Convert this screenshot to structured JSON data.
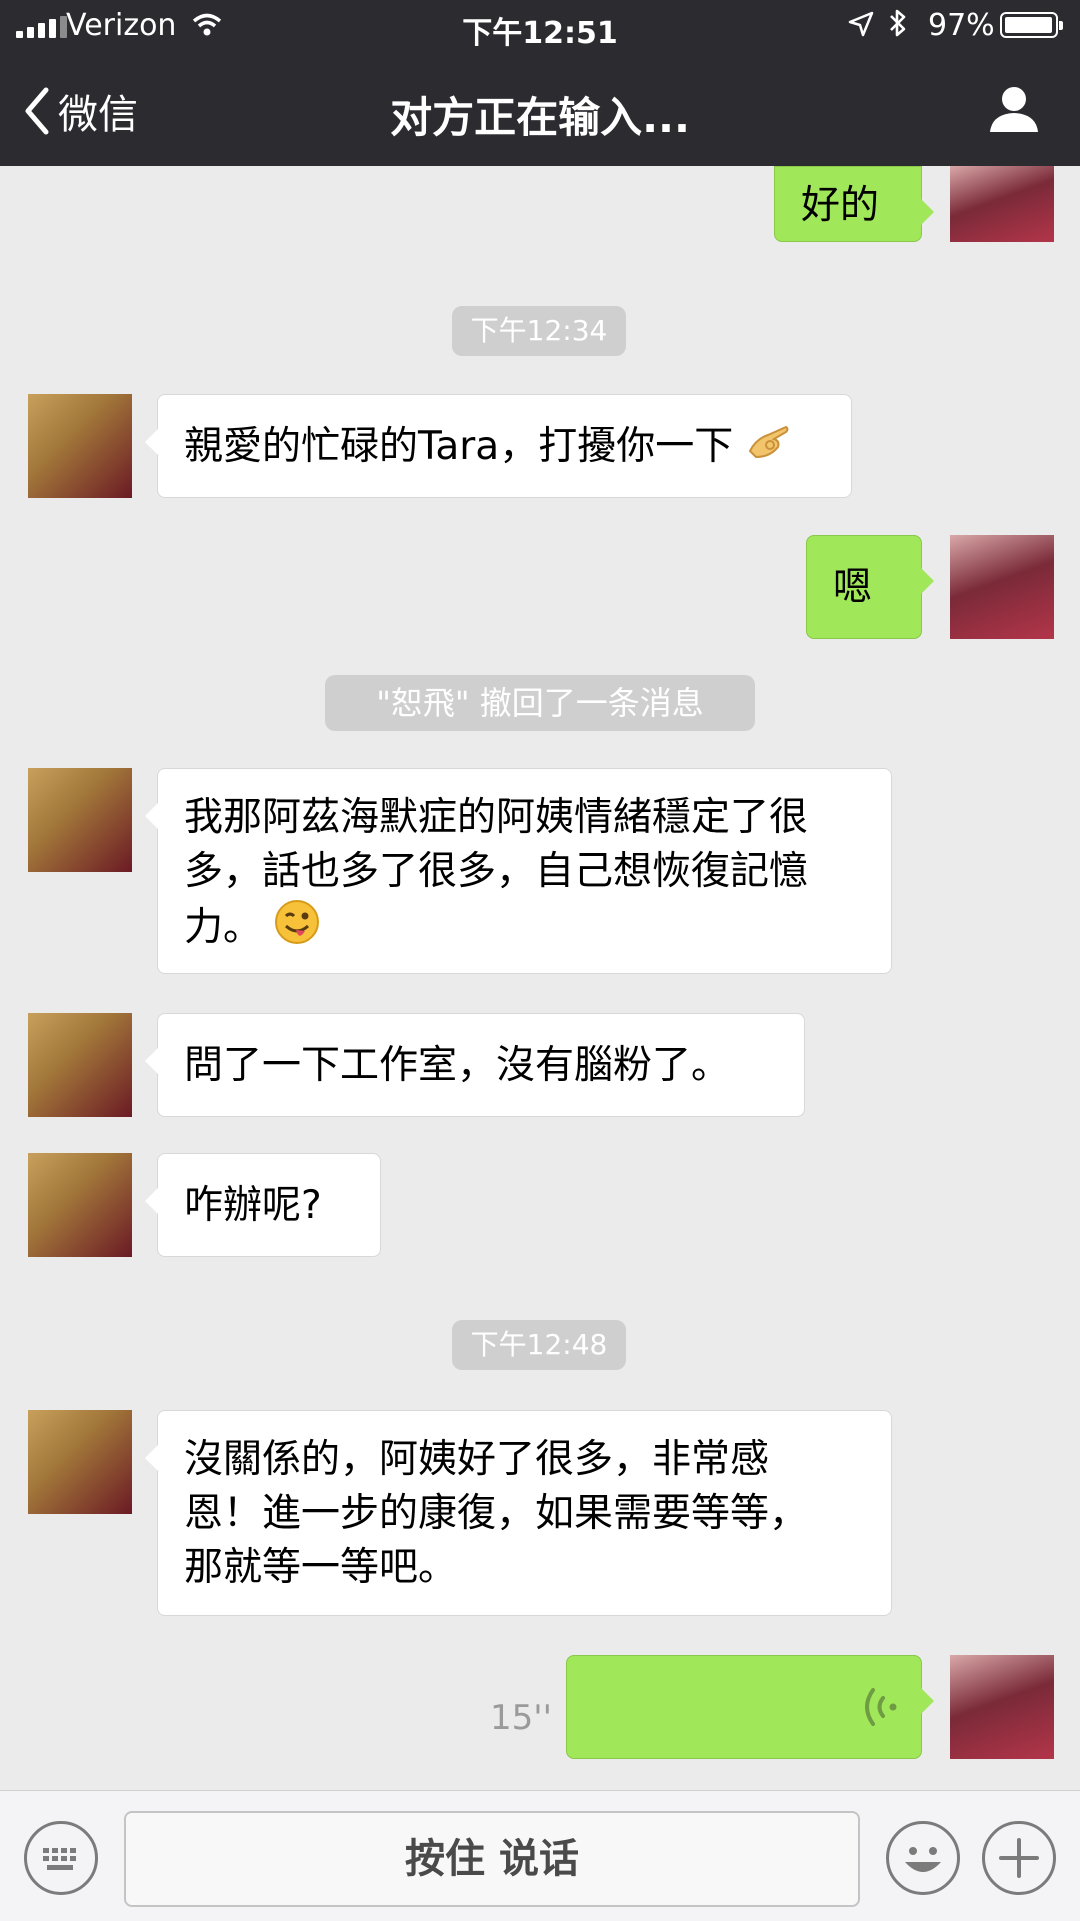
{
  "status_bar": {
    "carrier": "Verizon",
    "time": "下午12:51",
    "battery": "97%",
    "battery_level": 0.97
  },
  "nav": {
    "back_label": "微信",
    "title": "对方正在输入..."
  },
  "messages": {
    "m0": "好的",
    "t1": "下午12:34",
    "m1": "親愛的忙碌的Tara，打擾你一下",
    "m2": "嗯",
    "recall": "\"恕飛\" 撤回了一条消息",
    "m3_l1": "我那阿茲海默症的阿姨情緒穩定了很",
    "m3_l2": "多，話也多了很多，自己想恢復記憶",
    "m3_l3": "力。",
    "m4": "問了一下工作室，沒有腦粉了。",
    "m5": "咋辦呢?",
    "t2": "下午12:48",
    "m6_l1": "沒關係的，阿姨好了很多，非常感",
    "m6_l2": "恩！進一步的康復，如果需要等等，",
    "m6_l3": "那就等一等吧。",
    "voice_duration": "15''"
  },
  "input_bar": {
    "hold_to_talk": "按住 说话"
  },
  "colors": {
    "nav_bg": "#2c2b30",
    "chat_bg": "#ebebeb",
    "sent_bubble": "#a0e759",
    "received_bubble": "#ffffff"
  },
  "icons": [
    "signal-icon",
    "wifi-icon",
    "location-arrow-icon",
    "bluetooth-icon",
    "battery-icon",
    "back-chevron-icon",
    "person-icon",
    "ok-hand-emoji",
    "wink-tongue-emoji",
    "voice-wave-icon",
    "keyboard-icon",
    "smiley-icon",
    "plus-icon"
  ]
}
